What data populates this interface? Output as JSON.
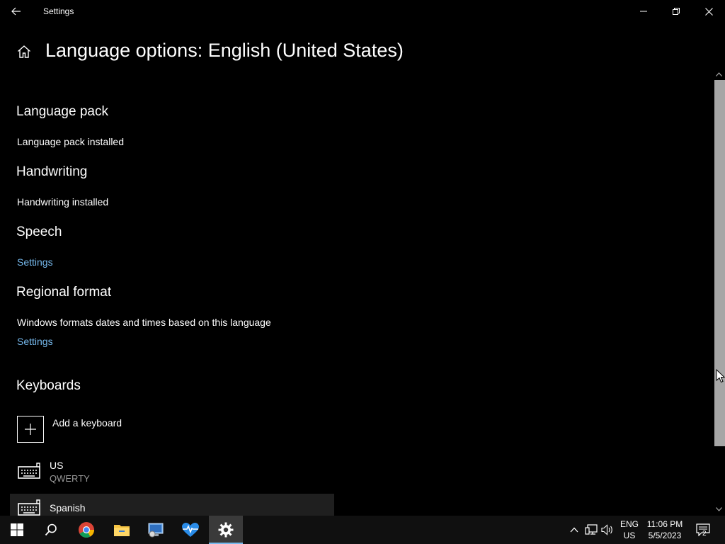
{
  "window": {
    "app_title": "Settings",
    "page_title": "Language options: English (United States)"
  },
  "sections": {
    "language_pack": {
      "title": "Language pack",
      "status": "Language pack installed"
    },
    "handwriting": {
      "title": "Handwriting",
      "status": "Handwriting installed"
    },
    "speech": {
      "title": "Speech",
      "link": "Settings"
    },
    "regional_format": {
      "title": "Regional format",
      "description": "Windows formats dates and times based on this language",
      "link": "Settings"
    },
    "keyboards": {
      "title": "Keyboards",
      "add_label": "Add a keyboard",
      "items": [
        {
          "name": "US",
          "layout": "QWERTY"
        },
        {
          "name": "Spanish",
          "layout": ""
        }
      ]
    }
  },
  "taskbar": {
    "apps": [
      "start-icon",
      "search-icon",
      "chrome-icon",
      "file-explorer-icon",
      "control-panel-icon",
      "health-monitor-icon",
      "settings-icon"
    ],
    "language": {
      "line1": "ENG",
      "line2": "US"
    },
    "clock": {
      "time": "11:06 PM",
      "date": "5/5/2023"
    },
    "notification_count": "2"
  },
  "colors": {
    "accent_link": "#76b9ed",
    "background": "#000000",
    "taskbar": "#101010",
    "scroll_thumb": "#a6a6a6"
  }
}
